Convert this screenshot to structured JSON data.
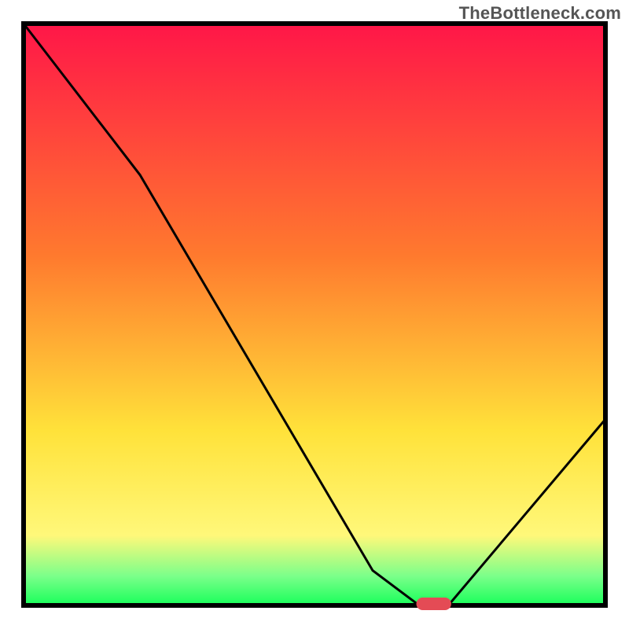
{
  "watermark": "TheBottleneck.com",
  "colors": {
    "frame_black": "#000000",
    "curve_black": "#000000",
    "marker_red": "#e44b55",
    "gradient_top_red": "#ff1648",
    "gradient_orange": "#ff7a2e",
    "gradient_yellow": "#ffe23a",
    "gradient_pale_yellow": "#fff87a",
    "gradient_pale_green": "#7aff8a",
    "gradient_green": "#18ff5a"
  },
  "chart_data": {
    "type": "line",
    "title": "",
    "xlabel": "",
    "ylabel": "",
    "xlim": [
      0,
      100
    ],
    "ylim": [
      0,
      100
    ],
    "background_gradient_vertical": true,
    "series": [
      {
        "name": "bottleneck-curve",
        "x": [
          0,
          20,
          60,
          68,
          73,
          100
        ],
        "y": [
          100,
          74,
          6,
          0,
          0,
          32
        ]
      }
    ],
    "marker": {
      "name": "sweet-spot-marker",
      "x": 70.5,
      "y": 0,
      "width_x_units": 6
    }
  }
}
